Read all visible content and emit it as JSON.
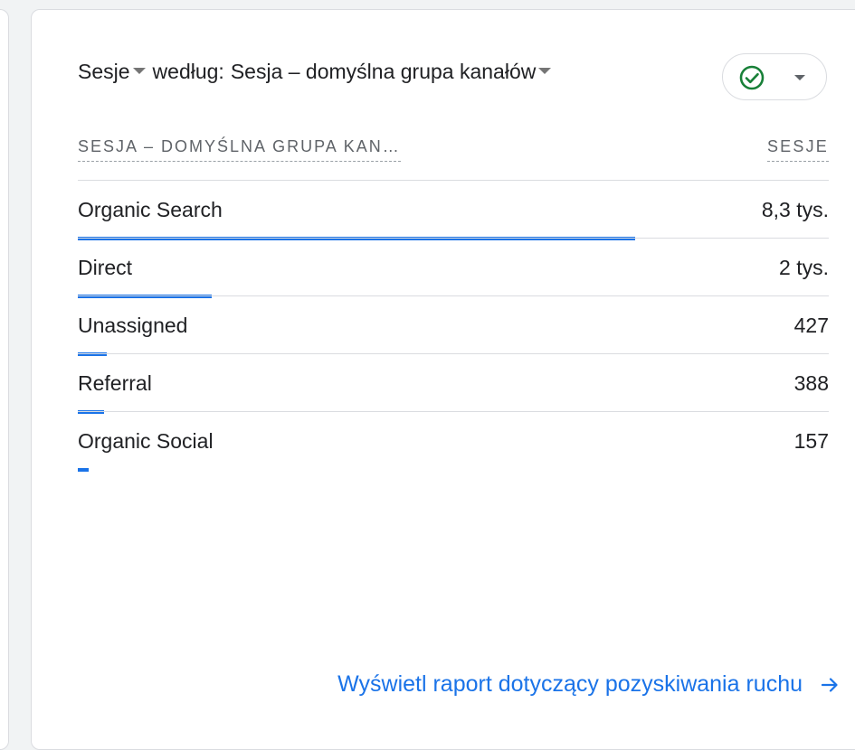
{
  "card": {
    "title": {
      "metric_label": "Sesje",
      "by_label": "według:",
      "dimension_label": "Sesja – domyślna grupa kanałów"
    },
    "status_icon": "check-circle-icon",
    "columns": {
      "dimension": "SESJA – DOMYŚLNA GRUPA KAN…",
      "metric": "SESJE"
    },
    "rows": [
      {
        "label": "Organic Search",
        "value": "8,3 tys.",
        "sessions": 8300
      },
      {
        "label": "Direct",
        "value": "2 tys.",
        "sessions": 2000
      },
      {
        "label": "Unassigned",
        "value": "427",
        "sessions": 427
      },
      {
        "label": "Referral",
        "value": "388",
        "sessions": 388
      },
      {
        "label": "Organic Social",
        "value": "157",
        "sessions": 157
      }
    ],
    "footer_link": "Wyświetl raport dotyczący pozyskiwania ruchu"
  },
  "colors": {
    "accent": "#1a73e8",
    "status_ok": "#188038",
    "text": "#202124",
    "muted": "#5f6368"
  }
}
